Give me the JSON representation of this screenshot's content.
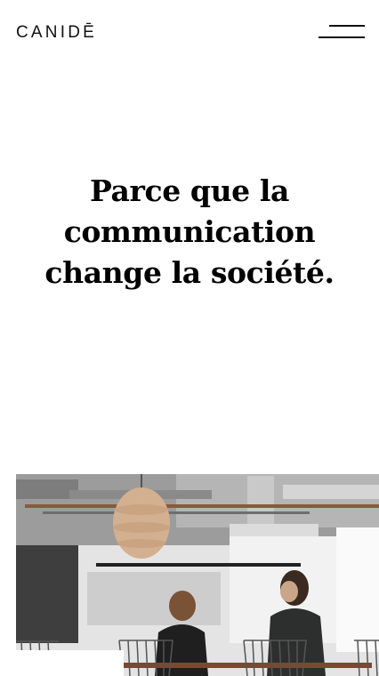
{
  "header": {
    "logo_text": "CANIDĒ",
    "menu_icon": "hamburger-menu-icon"
  },
  "hero": {
    "title": "Parce que la communication change la société."
  },
  "image": {
    "subject": "office-photo"
  },
  "colors": {
    "background": "#ffffff",
    "text": "#000000"
  }
}
